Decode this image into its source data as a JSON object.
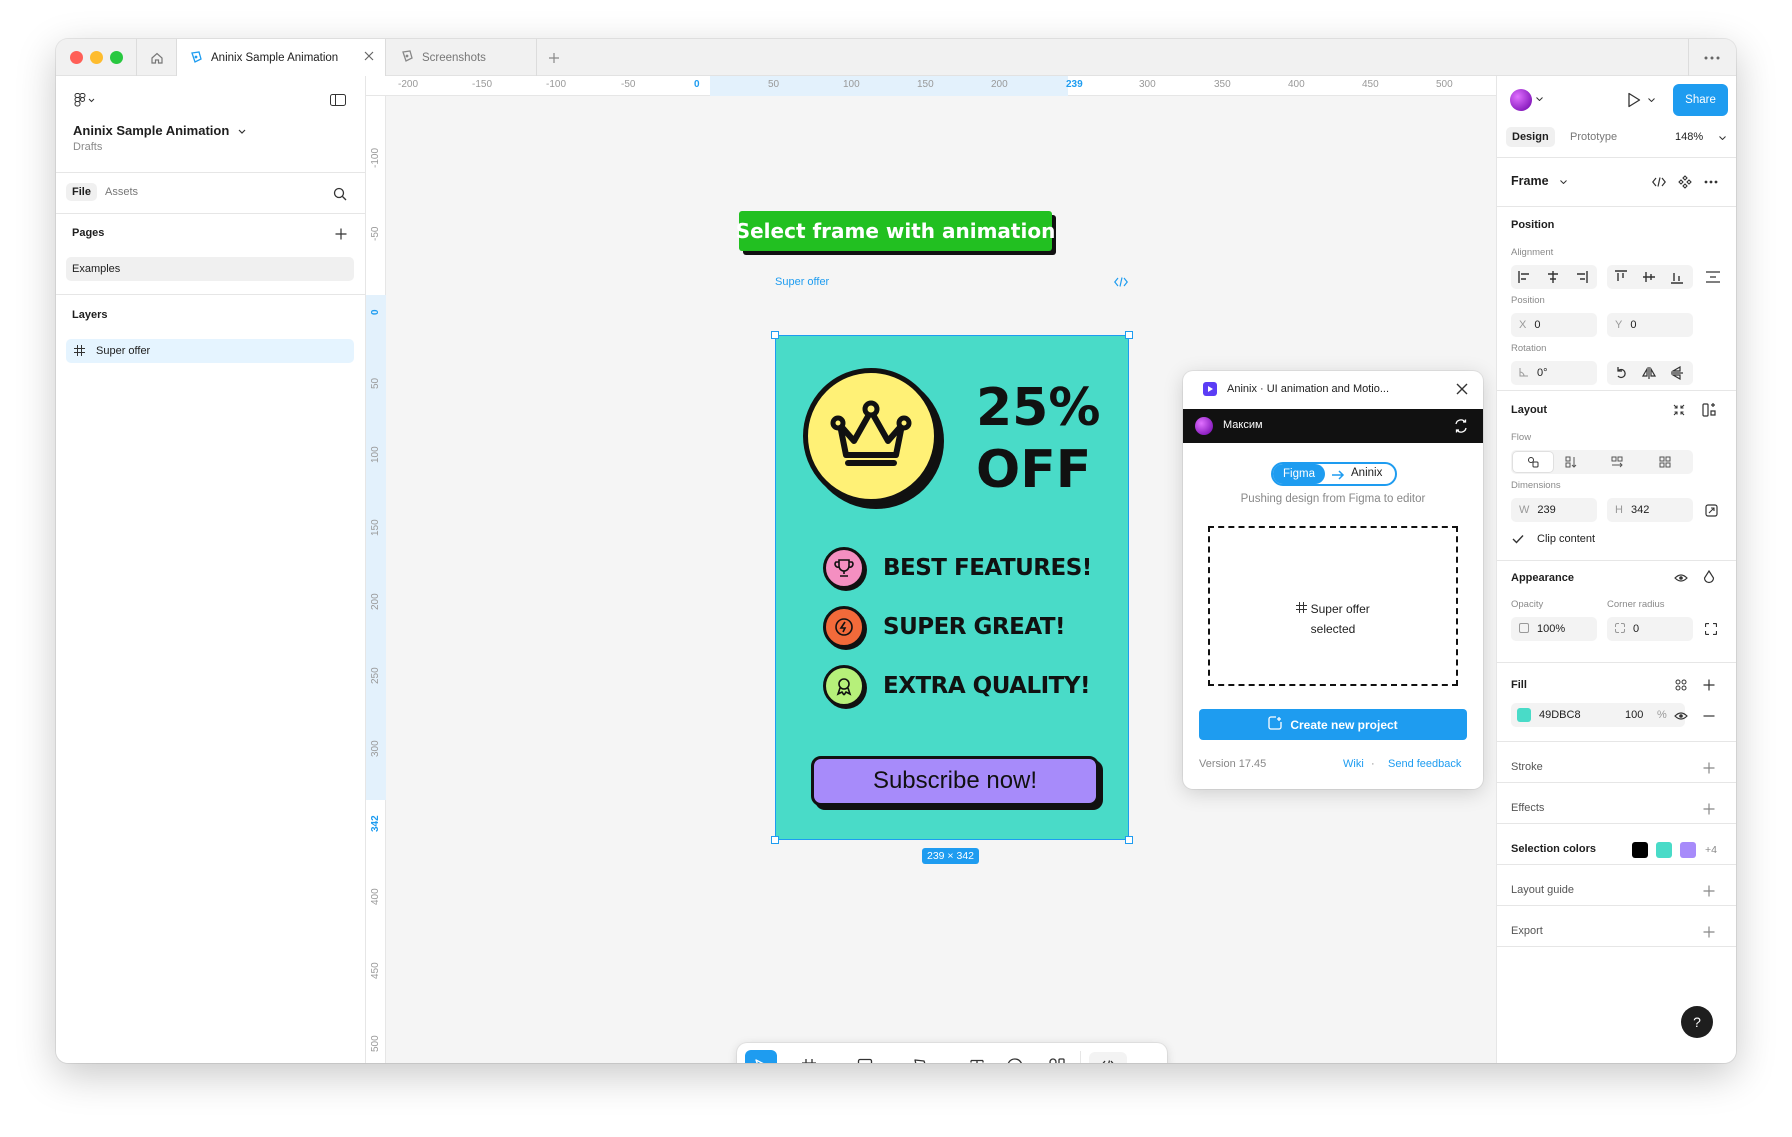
{
  "tabs": {
    "active": "Aninix Sample Animation",
    "second": "Screenshots"
  },
  "left_panel": {
    "project_name": "Aninix Sample Animation",
    "project_location": "Drafts",
    "tab_file": "File",
    "tab_assets": "Assets",
    "pages_header": "Pages",
    "pages": [
      "Examples"
    ],
    "layers_header": "Layers",
    "layers": [
      "Super offer"
    ]
  },
  "rulers": {
    "h": [
      "-200",
      "-150",
      "-100",
      "-50",
      "0",
      "50",
      "100",
      "150",
      "200",
      "239",
      "300",
      "350",
      "400",
      "450",
      "500"
    ],
    "v": [
      "-100",
      "-50",
      "0",
      "50",
      "100",
      "150",
      "200",
      "250",
      "300",
      "342",
      "400",
      "450",
      "500"
    ]
  },
  "canvas": {
    "callout": "Select frame with animation",
    "frame_label": "Super offer",
    "frame_size": "239 × 342"
  },
  "offer": {
    "discount_line1": "25%",
    "discount_line2": "OFF",
    "features": [
      "BEST FEATURES!",
      "SUPER GREAT!",
      "EXTRA QUALITY!"
    ],
    "cta": "Subscribe now!",
    "colors": {
      "bg": "#49DBC8",
      "crown": "#FFF176",
      "f1": "#F48FC1",
      "f2": "#F26A3A",
      "f3": "#B6F07A",
      "cta": "#A78BFA"
    }
  },
  "plugin": {
    "title": "Aninix · UI animation and Motio...",
    "user": "Максим",
    "chip_from": "Figma",
    "chip_to": "Aninix",
    "subtitle": "Pushing design from Figma to editor",
    "selected_name": "Super offer",
    "selected_status": "selected",
    "create_button": "Create new project",
    "version": "Version 17.45",
    "wiki": "Wiki",
    "separator": "·",
    "feedback": "Send feedback"
  },
  "right_panel": {
    "share": "Share",
    "tab_design": "Design",
    "tab_prototype": "Prototype",
    "zoom": "148%",
    "frame_title": "Frame",
    "position_header": "Position",
    "alignment_label": "Alignment",
    "position_label": "Position",
    "x_key": "X",
    "x_val": "0",
    "y_key": "Y",
    "y_val": "0",
    "rotation_label": "Rotation",
    "rotation_val": "0°",
    "layout_header": "Layout",
    "flow_label": "Flow",
    "dimensions_label": "Dimensions",
    "w_key": "W",
    "w_val": "239",
    "h_key": "H",
    "h_val": "342",
    "clip_content": "Clip content",
    "appearance_header": "Appearance",
    "opacity_label": "Opacity",
    "opacity_val": "100%",
    "corner_label": "Corner radius",
    "corner_val": "0",
    "fill_header": "Fill",
    "fill_hex": "49DBC8",
    "fill_opacity": "100",
    "fill_pct": "%",
    "stroke_header": "Stroke",
    "effects_header": "Effects",
    "selection_colors_header": "Selection colors",
    "selection_colors": [
      "#000000",
      "#49DBC8",
      "#A78BFA"
    ],
    "selection_more": "+4",
    "layout_guide_header": "Layout guide",
    "export_header": "Export",
    "help": "?"
  }
}
